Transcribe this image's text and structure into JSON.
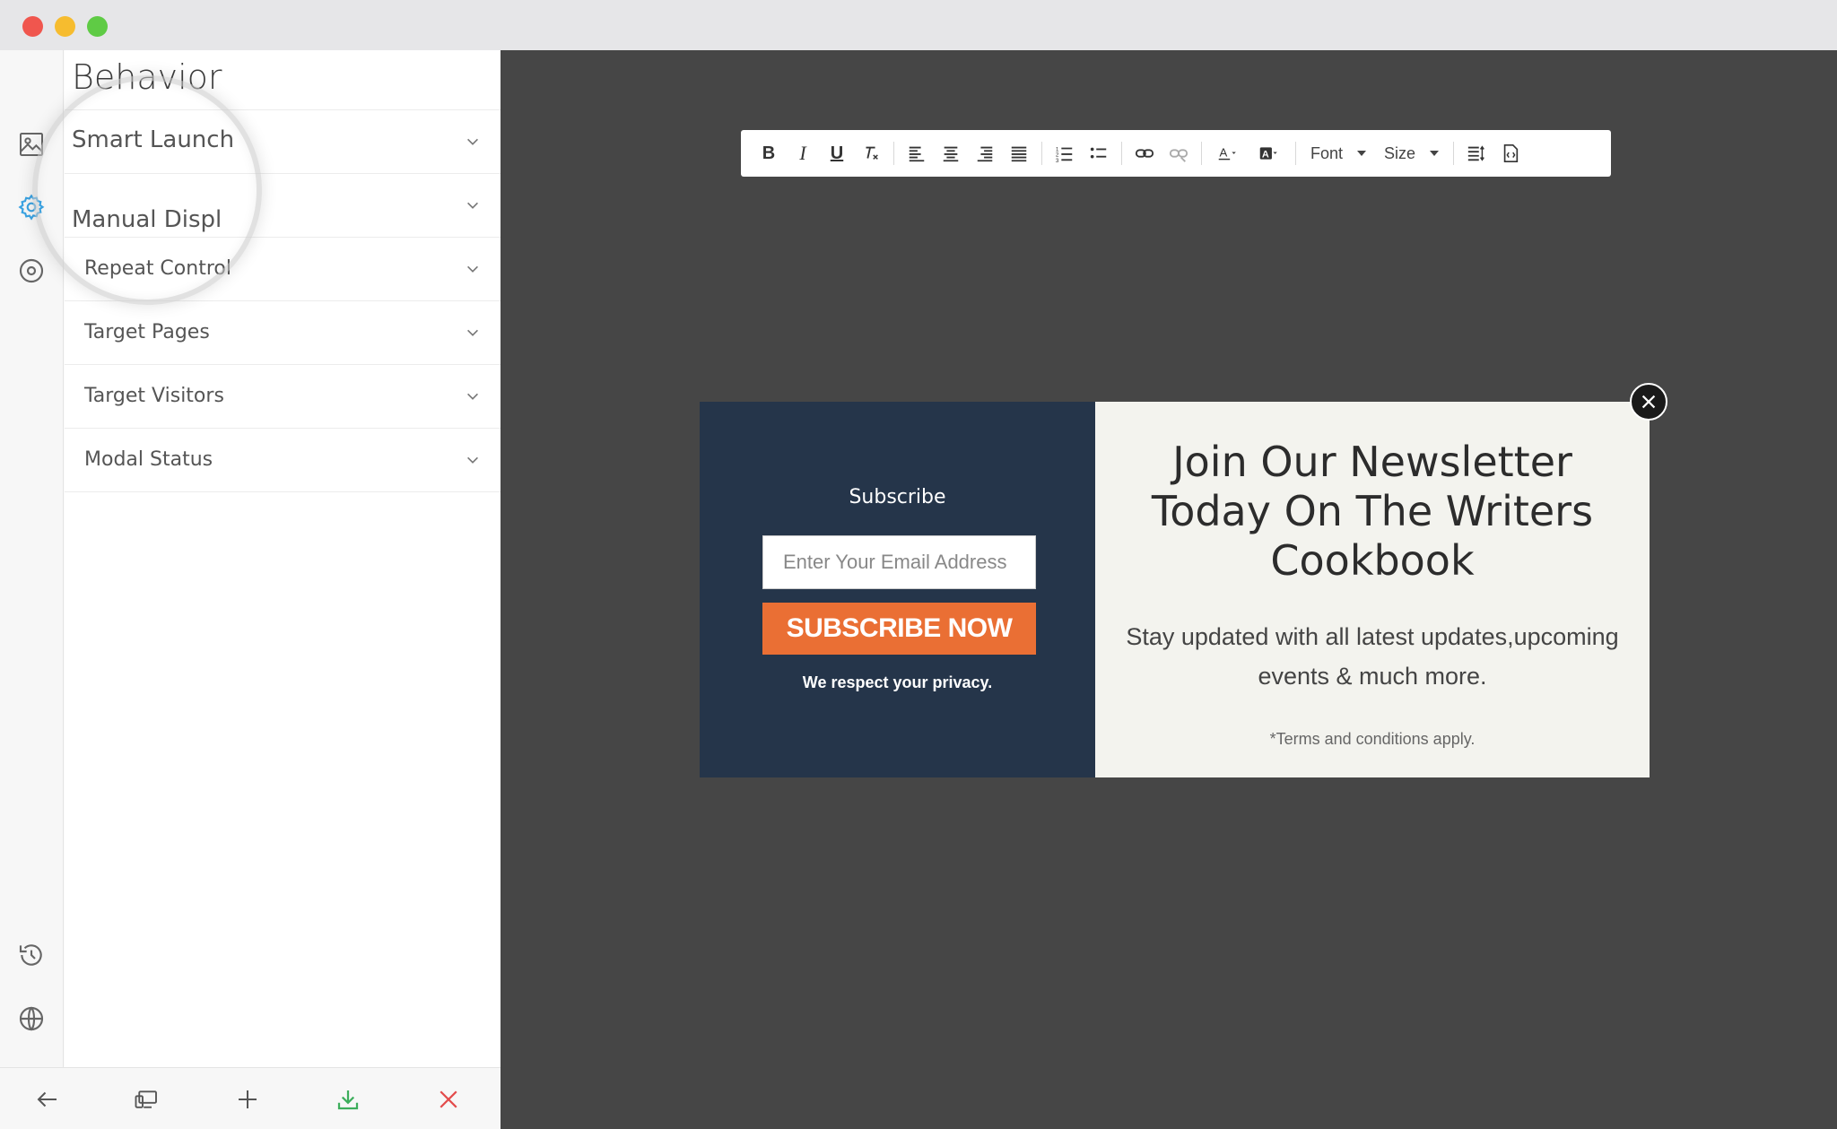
{
  "window": {
    "controls": [
      "close",
      "minimize",
      "zoom"
    ]
  },
  "sidebar": {
    "title": "Behavior",
    "rail_icons": [
      "image-icon",
      "gear-icon",
      "target-icon",
      "history-icon",
      "globe-icon"
    ],
    "items": [
      {
        "label": "Smart Launch"
      },
      {
        "label": "Manual Displ"
      },
      {
        "label": "Repeat Control"
      },
      {
        "label": "Target Pages"
      },
      {
        "label": "Target Visitors"
      },
      {
        "label": "Modal Status"
      }
    ],
    "bottom_actions": [
      "back-arrow-icon",
      "devices-icon",
      "plus-icon",
      "download-icon",
      "close-icon"
    ],
    "accent_color": "#3aa3e3"
  },
  "toolbar": {
    "bold": "B",
    "italic": "I",
    "underline": "U",
    "font_label": "Font",
    "size_label": "Size"
  },
  "popup": {
    "subscribe_heading": "Subscribe",
    "email_placeholder": "Enter Your Email Address",
    "button_label": "SUBSCRIBE NOW",
    "privacy": "We respect your privacy.",
    "headline": "Join Our Newsletter Today On The Writers Cookbook",
    "body": "Stay updated with all latest updates,upcoming events & much more.",
    "terms": "*Terms and conditions apply.",
    "colors": {
      "left_bg": "#25354a",
      "right_bg": "#f3f3ee",
      "button": "#ea6f34"
    }
  }
}
